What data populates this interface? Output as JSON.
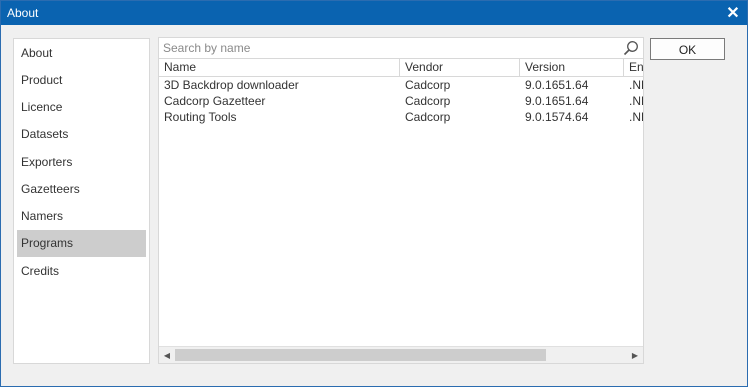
{
  "window": {
    "title": "About",
    "close_symbol": "✕"
  },
  "nav": {
    "items": [
      {
        "label": "About"
      },
      {
        "label": "Product"
      },
      {
        "label": "Licence"
      },
      {
        "label": "Datasets"
      },
      {
        "label": "Exporters"
      },
      {
        "label": "Gazetteers"
      },
      {
        "label": "Namers"
      },
      {
        "label": "Programs",
        "selected": true
      },
      {
        "label": "Credits"
      }
    ]
  },
  "search": {
    "placeholder": "Search by name",
    "value": "",
    "icon": "search-icon"
  },
  "table": {
    "columns": [
      "Name",
      "Vendor",
      "Version",
      "En"
    ],
    "rows": [
      [
        "3D Backdrop downloader",
        "Cadcorp",
        "9.0.1651.64",
        ".NE"
      ],
      [
        "Cadcorp Gazetteer",
        "Cadcorp",
        "9.0.1651.64",
        ".NE"
      ],
      [
        "Routing Tools",
        "Cadcorp",
        "9.0.1574.64",
        ".NE"
      ]
    ]
  },
  "scrollbar": {
    "left_arrow": "◀",
    "right_arrow": "▶",
    "position_fraction": 0.0,
    "visible_fraction": 0.82
  },
  "buttons": {
    "ok_label": "OK"
  }
}
